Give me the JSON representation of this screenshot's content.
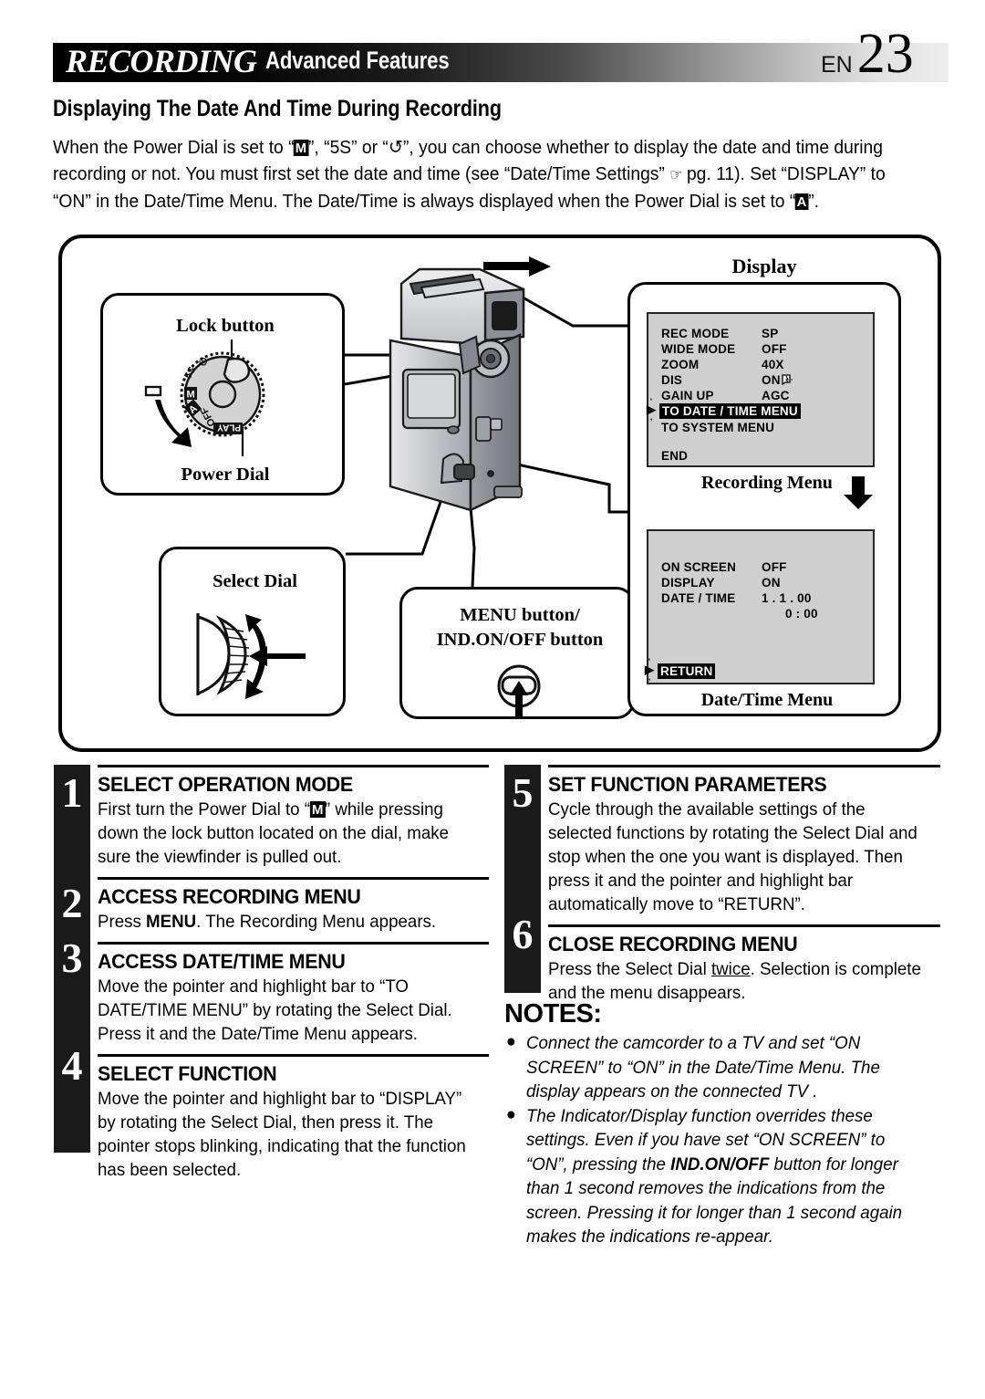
{
  "header": {
    "title_primary": "RECORDING",
    "title_secondary": "Advanced Features",
    "lang_code": "EN",
    "page_number": "23"
  },
  "subtitle": "Displaying The Date And Time During Recording",
  "intro": {
    "part1": "When the Power Dial is set to “",
    "glyph_m": "M",
    "part2": "”, “5S” or “",
    "glyph_timer": "↺",
    "part3": "”, you can choose whether to display the date and time during recording or not. You must first set the date and time (see “Date/Time Settings” ",
    "hand_icon": "☞",
    "part4": " pg. 11). Set “DISPLAY” to “ON” in the Date/Time Menu. The Date/Time is always displayed when the Power Dial is set to “",
    "glyph_a": "A",
    "part5": "”."
  },
  "diagram": {
    "power_dial_box": {
      "lock_button_label": "Lock button",
      "power_dial_label": "Power Dial",
      "dial_marks": [
        "⏻",
        "5S",
        "M",
        "A",
        "OFF",
        "PLAY"
      ]
    },
    "select_dial_box": {
      "label": "Select Dial"
    },
    "menu_button_box": {
      "label_line1": "MENU button/",
      "label_line2": "IND.ON/OFF button"
    },
    "display_box": {
      "title": "Display",
      "recording_menu_caption": "Recording Menu",
      "date_time_menu_caption": "Date/Time Menu",
      "recording_menu": {
        "rows": [
          {
            "key": "REC MODE",
            "value": "SP"
          },
          {
            "key": "WIDE MODE",
            "value": "OFF"
          },
          {
            "key": "ZOOM",
            "value": "40X"
          },
          {
            "key": "DIS",
            "value": "ON"
          },
          {
            "key": "GAIN UP",
            "value": "AGC"
          }
        ],
        "highlighted": "TO DATE / TIME MENU",
        "next_item": "TO SYSTEM MENU",
        "end_item": "END"
      },
      "date_time_menu": {
        "rows": [
          {
            "key": "ON SCREEN",
            "value": "OFF"
          },
          {
            "key": "DISPLAY",
            "value": "ON"
          },
          {
            "key": "DATE / TIME",
            "value": "1 .   1 . 00"
          }
        ],
        "time_value": "0 : 00",
        "highlighted": "RETURN"
      }
    }
  },
  "steps_left": [
    {
      "number": "1",
      "title": "SELECT OPERATION MODE",
      "body_pre": "First turn the Power Dial to “",
      "body_glyph": "M",
      "body_post": "” while pressing down the lock button located on the dial, make sure the viewfinder is pulled out."
    },
    {
      "number": "2",
      "title": "ACCESS RECORDING MENU",
      "body_pre": "Press ",
      "body_bold": "MENU",
      "body_post": ". The Recording Menu appears."
    },
    {
      "number": "3",
      "title": "ACCESS DATE/TIME MENU",
      "body": "Move the pointer and highlight bar to “TO DATE/TIME MENU” by rotating the Select Dial. Press it and the Date/Time Menu appears."
    },
    {
      "number": "4",
      "title": "SELECT FUNCTION",
      "body": "Move the pointer and highlight bar to “DISPLAY” by rotating the Select Dial, then press it. The pointer stops blinking, indicating that the function has been selected."
    }
  ],
  "steps_right": [
    {
      "number": "5",
      "title": "SET FUNCTION PARAMETERS",
      "body": "Cycle through the available settings of the selected functions by rotating the Select Dial and stop when the one you want is displayed. Then press it and the pointer and highlight bar automatically move to “RETURN”."
    },
    {
      "number": "6",
      "title": "CLOSE RECORDING MENU",
      "body_pre": "Press the Select Dial ",
      "body_underline": "twice",
      "body_post": ". Selection is complete and the menu disappears."
    }
  ],
  "notes": {
    "title": "NOTES:",
    "items": [
      {
        "text": "Connect the camcorder to a TV and set “ON SCREEN” to “ON” in the Date/Time Menu. The display appears on the connected TV ."
      },
      {
        "pre": "The Indicator/Display function overrides these settings. Even if you have set “ON SCREEN” to “ON”, pressing the ",
        "bold": "IND.ON/OFF",
        "post": " button for longer than 1 second removes the indications from the screen. Pressing it for longer than 1 second again makes the indications re-appear."
      }
    ]
  },
  "colors": {
    "ink": "#000000",
    "osd_background": "#cfcfcf",
    "bar_black": "#1a1a1a"
  }
}
